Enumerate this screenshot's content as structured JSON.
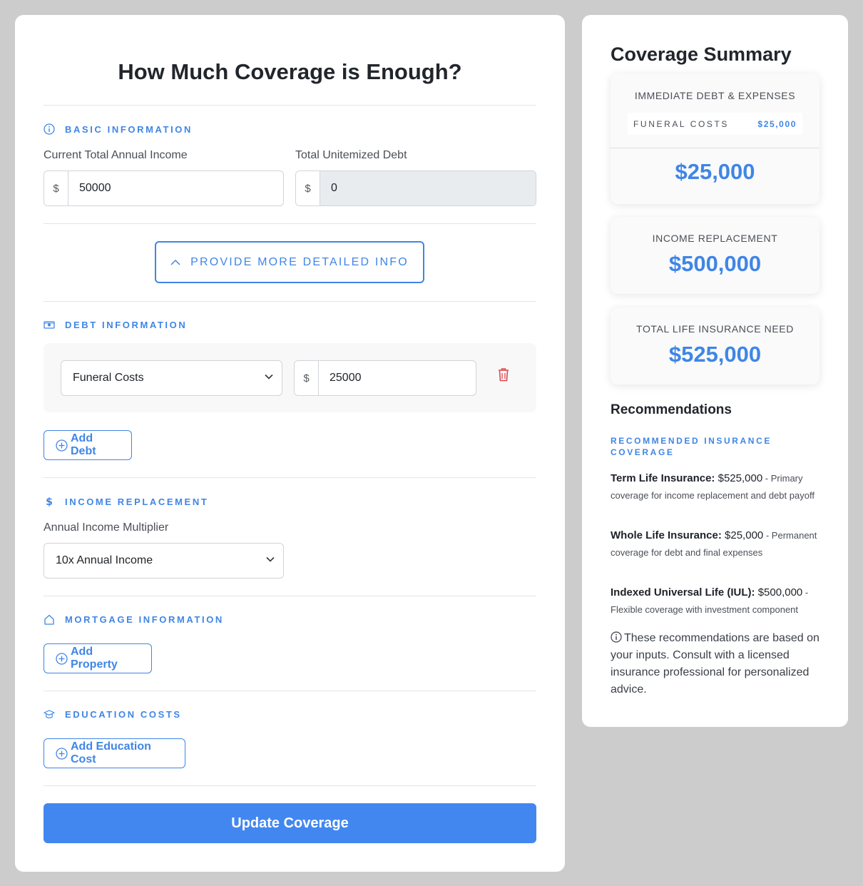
{
  "main": {
    "title": "How Much Coverage is Enough?",
    "basic": {
      "heading": "BASIC INFORMATION",
      "income_label": "Current Total Annual Income",
      "income_value": "50000",
      "debt_label": "Total Unitemized Debt",
      "debt_value": "0",
      "currency": "$"
    },
    "more_info_button": "PROVIDE MORE DETAILED INFO",
    "debt": {
      "heading": "DEBT INFORMATION",
      "type_selected": "Funeral Costs",
      "amount": "25000",
      "currency": "$",
      "add_button": "Add Debt"
    },
    "income_replacement": {
      "heading": "INCOME REPLACEMENT",
      "multiplier_label": "Annual Income Multiplier",
      "multiplier_selected": "10x Annual Income"
    },
    "mortgage": {
      "heading": "MORTGAGE INFORMATION",
      "add_button": "Add Property"
    },
    "education": {
      "heading": "EDUCATION COSTS",
      "add_button": "Add Education Cost"
    },
    "update_button": "Update Coverage"
  },
  "summary": {
    "title": "Coverage Summary",
    "immediate": {
      "label": "IMMEDIATE DEBT & EXPENSES",
      "item_name": "FUNERAL COSTS",
      "item_value": "$25,000",
      "total": "$25,000"
    },
    "income_replacement": {
      "label": "INCOME REPLACEMENT",
      "value": "$500,000"
    },
    "total_need": {
      "label": "TOTAL LIFE INSURANCE NEED",
      "value": "$525,000"
    },
    "recommendations": {
      "title": "Recommendations",
      "subtitle": "RECOMMENDED INSURANCE COVERAGE",
      "items": [
        {
          "name": "Term Life Insurance:",
          "amount": " $525,000",
          "desc": " - Primary coverage for income replacement and debt payoff"
        },
        {
          "name": "Whole Life Insurance:",
          "amount": " $25,000",
          "desc": " - Permanent coverage for debt and final expenses"
        },
        {
          "name": "Indexed Universal Life (IUL):",
          "amount": " $500,000",
          "desc": " - Flexible coverage with investment component"
        }
      ],
      "note": "These recommendations are based on your inputs. Consult with a licensed insurance professional for personalized advice."
    }
  },
  "colors": {
    "accent": "#3f86e6",
    "primary_button": "#4287f0",
    "danger": "#e0474c",
    "background": "#cccccc"
  }
}
